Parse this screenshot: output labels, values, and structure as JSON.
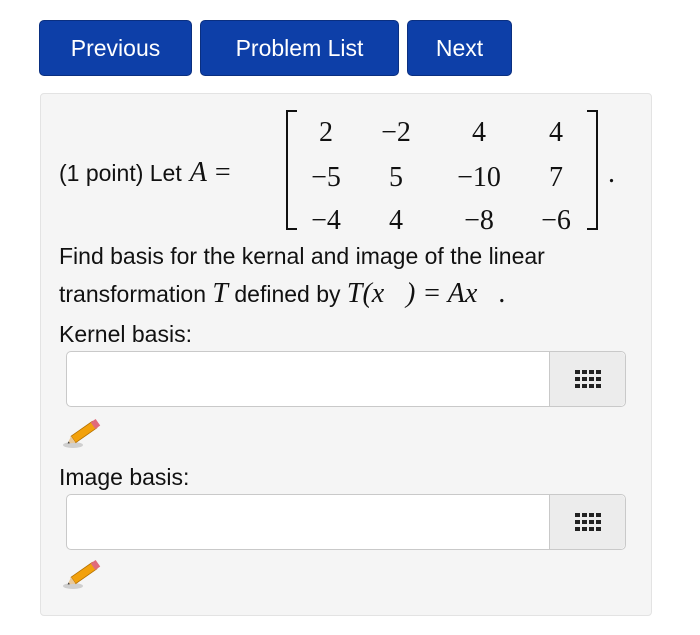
{
  "nav": {
    "previous": "Previous",
    "problem_list": "Problem List",
    "next": "Next"
  },
  "problem": {
    "points": "(1 point) Let",
    "matrix_var": "A",
    "equals": "=",
    "matrix": [
      [
        "2",
        "−2",
        "4",
        "4"
      ],
      [
        "−5",
        "5",
        "−10",
        "7"
      ],
      [
        "−4",
        "4",
        "−8",
        "−6"
      ]
    ],
    "period": ".",
    "line1": "Find basis for the kernal and image of the linear",
    "line2_text": "transformation",
    "line2_T": "T",
    "line2_mid": "defined by",
    "line2_formula": "T(x⃗) = Ax⃗.",
    "kernel_label": "Kernel basis:",
    "image_label": "Image basis:"
  },
  "answers": {
    "kernel_value": "",
    "image_value": ""
  },
  "icons": {
    "keyboard": "keyboard-grid-icon",
    "pencil": "pencil-icon"
  },
  "colors": {
    "nav_button": "#0d3fa8",
    "panel_bg": "#f5f5f5"
  }
}
